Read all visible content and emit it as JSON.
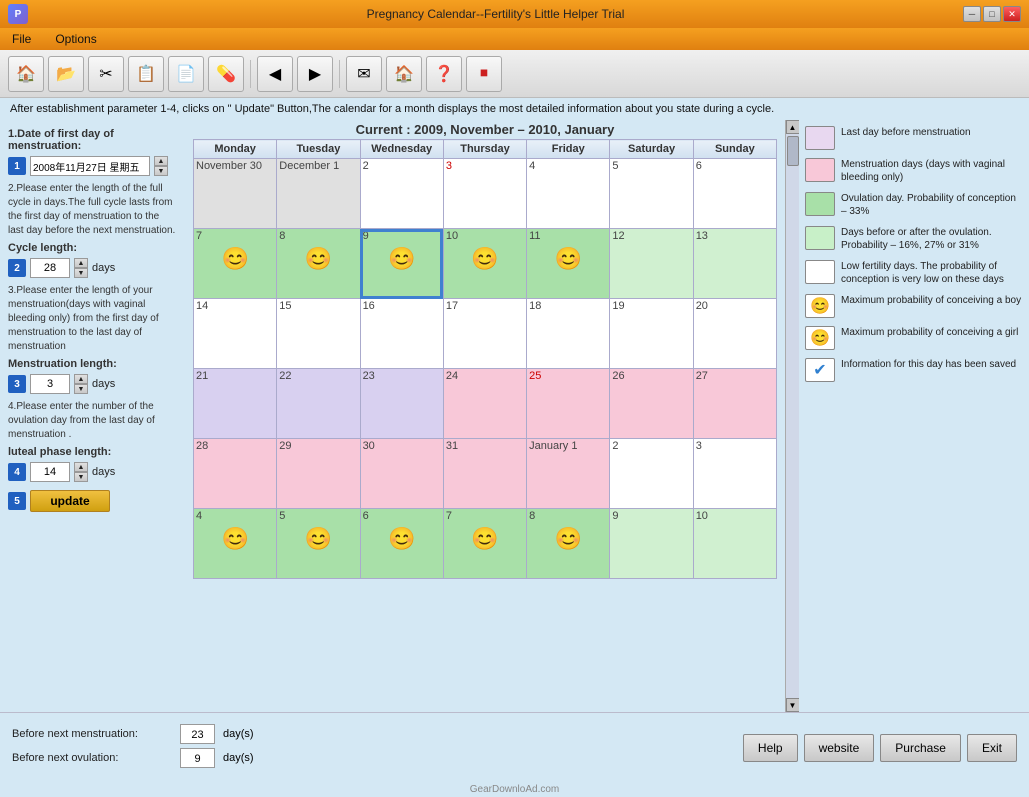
{
  "titleBar": {
    "title": "Pregnancy Calendar--Fertility's Little Helper  Trial",
    "appIconLabel": "P",
    "minimize": "─",
    "maximize": "□",
    "close": "✕"
  },
  "menuBar": {
    "items": [
      "File",
      "Options"
    ]
  },
  "toolbar": {
    "buttons": [
      "🏠",
      "📁",
      "✂",
      "📋",
      "📄",
      "💊",
      "←",
      "→",
      "✉",
      "🏠",
      "❓",
      "⏹"
    ]
  },
  "topInfo": {
    "line1": "After establishment parameter 1-4, clicks on \" Update\" Button,The calendar for a month displays the most detailed information about you state during a cycle.",
    "currentPeriod": "Current : 2009, November – 2010, January"
  },
  "leftPanel": {
    "section1": {
      "num": "1",
      "label": "1.Date of first  day of menstruation:",
      "dateValue": "2008年11月27日 星期五"
    },
    "section2": {
      "num": "2",
      "label": "2.Please enter the length of the full cycle in days.The full cycle lasts from the first day of menstruation to the last day before the next menstruation.",
      "sublabel": "Cycle length:",
      "numBadge": "2",
      "value": "28",
      "unit": "days"
    },
    "section3": {
      "num": "3",
      "label": "3.Please enter the length of your menstruation(days with vaginal bleeding only) from the first day of menstruation to the last day of menstruation",
      "sublabel": "Menstruation length:",
      "numBadge": "3",
      "value": "3",
      "unit": "days"
    },
    "section4": {
      "num": "4",
      "label": "4.Please enter the number of the ovulation day from the last day of menstruation .",
      "sublabel": "luteal phase length:",
      "numBadge": "4",
      "value": "14",
      "unit": "days"
    },
    "updateBtn": {
      "num": "5",
      "label": "update"
    }
  },
  "calendar": {
    "headers": [
      "Monday",
      "Tuesday",
      "Wednesday",
      "Thursday",
      "Friday",
      "Saturday",
      "Sunday"
    ],
    "rows": [
      [
        {
          "num": "November 30",
          "type": "gray",
          "face": null
        },
        {
          "num": "December 1",
          "type": "gray",
          "face": null
        },
        {
          "num": "2",
          "type": "white",
          "face": null
        },
        {
          "num": "3",
          "type": "white",
          "face": null,
          "redNum": true
        },
        {
          "num": "4",
          "type": "white",
          "face": null
        },
        {
          "num": "5",
          "type": "white",
          "face": null
        },
        {
          "num": "6",
          "type": "white",
          "face": null
        }
      ],
      [
        {
          "num": "7",
          "type": "green",
          "face": "girl"
        },
        {
          "num": "8",
          "type": "green",
          "face": "girl"
        },
        {
          "num": "9",
          "type": "green",
          "face": "girl",
          "selected": true
        },
        {
          "num": "10",
          "type": "green",
          "face": "girl"
        },
        {
          "num": "11",
          "type": "green",
          "face": "girl"
        },
        {
          "num": "12",
          "type": "lightgreen",
          "face": null
        },
        {
          "num": "13",
          "type": "lightgreen",
          "face": null
        }
      ],
      [
        {
          "num": "14",
          "type": "white",
          "face": null
        },
        {
          "num": "15",
          "type": "white",
          "face": null
        },
        {
          "num": "16",
          "type": "white",
          "face": null
        },
        {
          "num": "17",
          "type": "white",
          "face": null
        },
        {
          "num": "18",
          "type": "white",
          "face": null
        },
        {
          "num": "19",
          "type": "white",
          "face": null
        },
        {
          "num": "20",
          "type": "white",
          "face": null
        }
      ],
      [
        {
          "num": "21",
          "type": "purple",
          "face": null
        },
        {
          "num": "22",
          "type": "purple",
          "face": null
        },
        {
          "num": "23",
          "type": "purple",
          "face": null
        },
        {
          "num": "24",
          "type": "pink",
          "face": null
        },
        {
          "num": "25",
          "type": "pink",
          "face": null,
          "redNum": true
        },
        {
          "num": "26",
          "type": "pink",
          "face": null
        },
        {
          "num": "27",
          "type": "pink",
          "face": null
        }
      ],
      [
        {
          "num": "28",
          "type": "pink",
          "face": null
        },
        {
          "num": "29",
          "type": "pink",
          "face": null
        },
        {
          "num": "30",
          "type": "pink",
          "face": null
        },
        {
          "num": "31",
          "type": "pink",
          "face": null
        },
        {
          "num": "January 1",
          "type": "pink",
          "face": null
        },
        {
          "num": "2",
          "type": "white",
          "face": null
        },
        {
          "num": "3",
          "type": "white",
          "face": null
        }
      ],
      [
        {
          "num": "4",
          "type": "green",
          "face": "girl"
        },
        {
          "num": "5",
          "type": "green",
          "face": "girl"
        },
        {
          "num": "6",
          "type": "green",
          "face": "girl"
        },
        {
          "num": "7",
          "type": "green",
          "face": "boy"
        },
        {
          "num": "8",
          "type": "green",
          "face": "boy"
        },
        {
          "num": "9",
          "type": "lightgreen",
          "face": null
        },
        {
          "num": "10",
          "type": "lightgreen",
          "face": null
        }
      ]
    ]
  },
  "legend": {
    "items": [
      {
        "color": "#e8d8f0",
        "text": "Last day before menstruation"
      },
      {
        "color": "#f8c8d8",
        "text": "Menstruation days (days with vaginal bleeding only)"
      },
      {
        "color": "#a8e0a8",
        "text": "Ovulation day. Probability of conception – 33%"
      },
      {
        "color": "#c8f0c8",
        "text": "Days before or after the ovulation. Probability – 16%, 27% or 31%"
      },
      {
        "color": "white",
        "text": "Low fertility days. The probability of conception is very low on these days"
      },
      {
        "color": "white",
        "face": "boy",
        "text": "Maximum probability of conceiving a boy"
      },
      {
        "color": "white",
        "face": "girl",
        "text": "Maximum probability of conceiving a girl"
      },
      {
        "color": "white",
        "check": true,
        "text": "Information for this day has been saved"
      }
    ]
  },
  "bottomBar": {
    "row1Label": "Before next  menstruation:",
    "row1Value": "23",
    "row1Unit": "day(s)",
    "row2Label": "Before next ovulation:",
    "row2Value": "9",
    "row2Unit": "day(s)",
    "buttons": [
      "Help",
      "website",
      "Purchase",
      "Exit"
    ]
  },
  "watermark": "GearDownloAd.com"
}
